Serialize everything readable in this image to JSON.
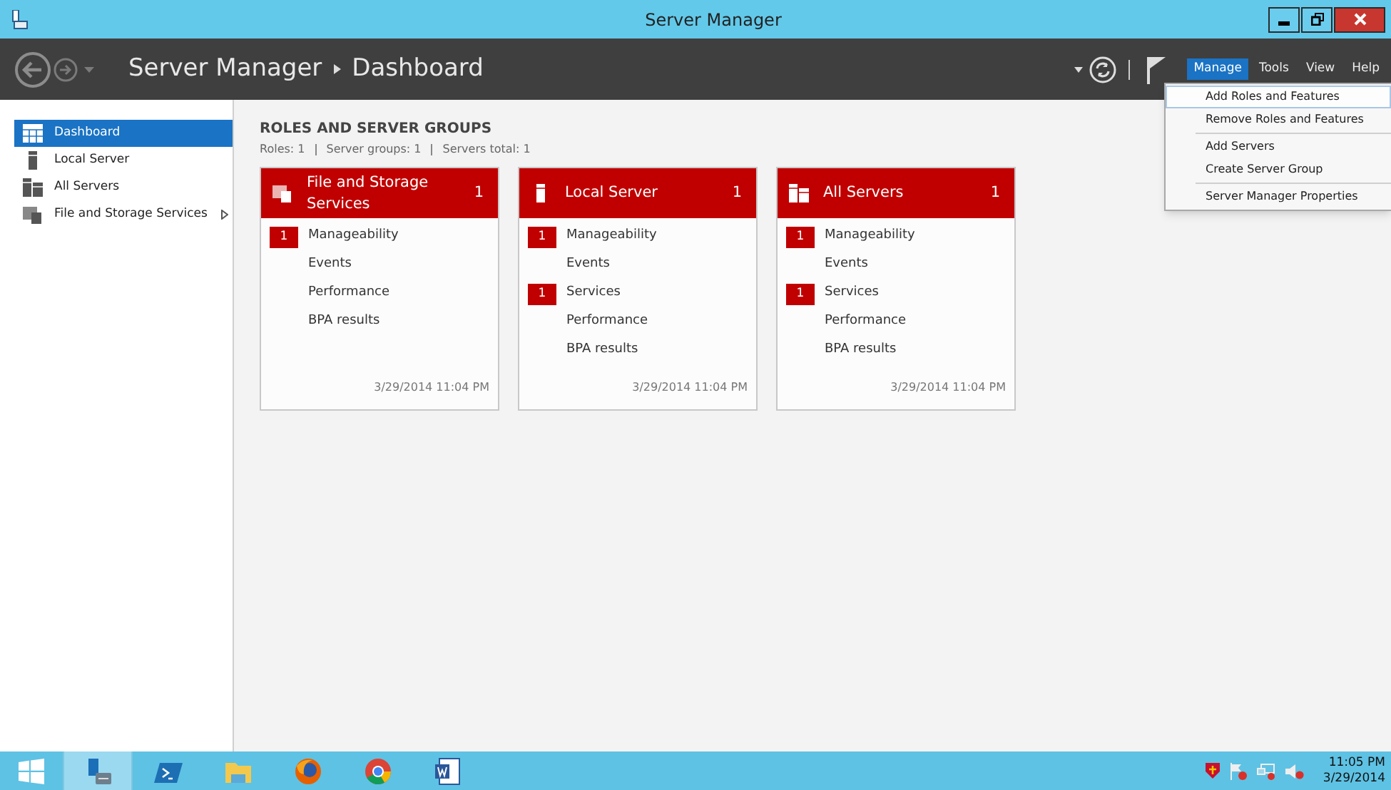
{
  "window": {
    "title": "Server Manager"
  },
  "header": {
    "breadcrumb": [
      {
        "label": "Server Manager"
      },
      {
        "label": "Dashboard"
      }
    ],
    "menu": [
      {
        "label": "Manage",
        "selected": true
      },
      {
        "label": "Tools",
        "selected": false
      },
      {
        "label": "View",
        "selected": false
      },
      {
        "label": "Help",
        "selected": false
      }
    ]
  },
  "dropdown": {
    "groups": [
      [
        {
          "label": "Add Roles and Features",
          "selected": true
        },
        {
          "label": "Remove Roles and Features",
          "selected": false
        }
      ],
      [
        {
          "label": "Add Servers",
          "selected": false
        },
        {
          "label": "Create Server Group",
          "selected": false
        }
      ],
      [
        {
          "label": "Server Manager Properties",
          "selected": false
        }
      ]
    ]
  },
  "sidebar": {
    "items": [
      {
        "label": "Dashboard",
        "kind": "dashboard",
        "selected": true,
        "has_submenu": false
      },
      {
        "label": "Local Server",
        "kind": "server",
        "selected": false,
        "has_submenu": false
      },
      {
        "label": "All Servers",
        "kind": "servers",
        "selected": false,
        "has_submenu": false
      },
      {
        "label": "File and Storage Services",
        "kind": "files",
        "selected": false,
        "has_submenu": true
      }
    ]
  },
  "section": {
    "title": "ROLES AND SERVER GROUPS",
    "summary": [
      "Roles: 1",
      "Server groups: 1",
      "Servers total: 1"
    ]
  },
  "cards": [
    {
      "title": "File and Storage Services",
      "kind": "files",
      "count": "1",
      "rows": [
        {
          "label": "Manageability",
          "badge": "1"
        },
        {
          "label": "Events"
        },
        {
          "label": "Performance"
        },
        {
          "label": "BPA results"
        }
      ],
      "timestamp": "3/29/2014 11:04 PM"
    },
    {
      "title": "Local Server",
      "kind": "server",
      "count": "1",
      "rows": [
        {
          "label": "Manageability",
          "badge": "1"
        },
        {
          "label": "Events"
        },
        {
          "label": "Services",
          "badge": "1"
        },
        {
          "label": "Performance"
        },
        {
          "label": "BPA results"
        }
      ],
      "timestamp": "3/29/2014 11:04 PM"
    },
    {
      "title": "All Servers",
      "kind": "servers",
      "count": "1",
      "rows": [
        {
          "label": "Manageability",
          "badge": "1"
        },
        {
          "label": "Events"
        },
        {
          "label": "Services",
          "badge": "1"
        },
        {
          "label": "Performance"
        },
        {
          "label": "BPA results"
        }
      ],
      "timestamp": "3/29/2014 11:04 PM"
    }
  ],
  "taskbar": {
    "apps": [
      {
        "kind": "server-manager",
        "selected": true
      },
      {
        "kind": "powershell",
        "selected": false
      },
      {
        "kind": "explorer",
        "selected": false
      },
      {
        "kind": "firefox",
        "selected": false
      },
      {
        "kind": "chrome",
        "selected": false
      },
      {
        "kind": "word",
        "selected": false
      }
    ],
    "clock": {
      "time": "11:05 PM",
      "date": "3/29/2014"
    }
  }
}
